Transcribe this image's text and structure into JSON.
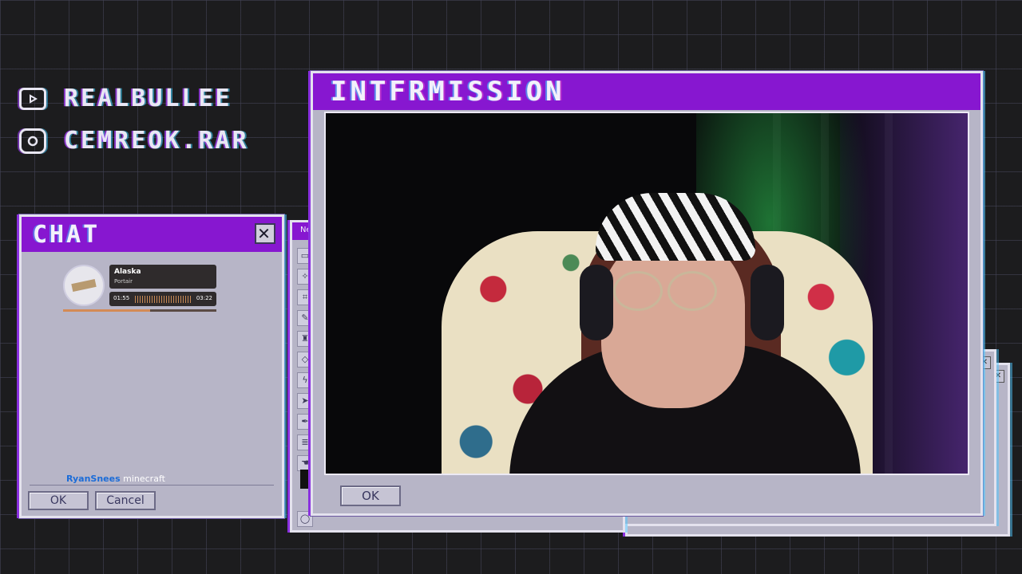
{
  "socials": [
    {
      "icon": "youtube-icon",
      "handle": "REALBULLEE"
    },
    {
      "icon": "instagram-icon",
      "handle": "CEMREOK.RAR"
    }
  ],
  "main_window": {
    "title": "INTFRMISSION",
    "ok_label": "OK"
  },
  "tools_window": {
    "title_fragment": "Ne"
  },
  "chat_window": {
    "title": "CHAT",
    "close_label": "✕",
    "now_playing": {
      "title": "Alaska",
      "artist": "Portair",
      "elapsed": "01:55",
      "duration": "03:22",
      "progress": 0.57
    },
    "message": {
      "user": "RyanSnees",
      "text": "minecraft"
    },
    "ok_label": "OK",
    "cancel_label": "Cancel"
  },
  "colors": {
    "accent": "#8717d0",
    "window_bg": "#b7b5c7",
    "background": "#1c1c1e"
  }
}
